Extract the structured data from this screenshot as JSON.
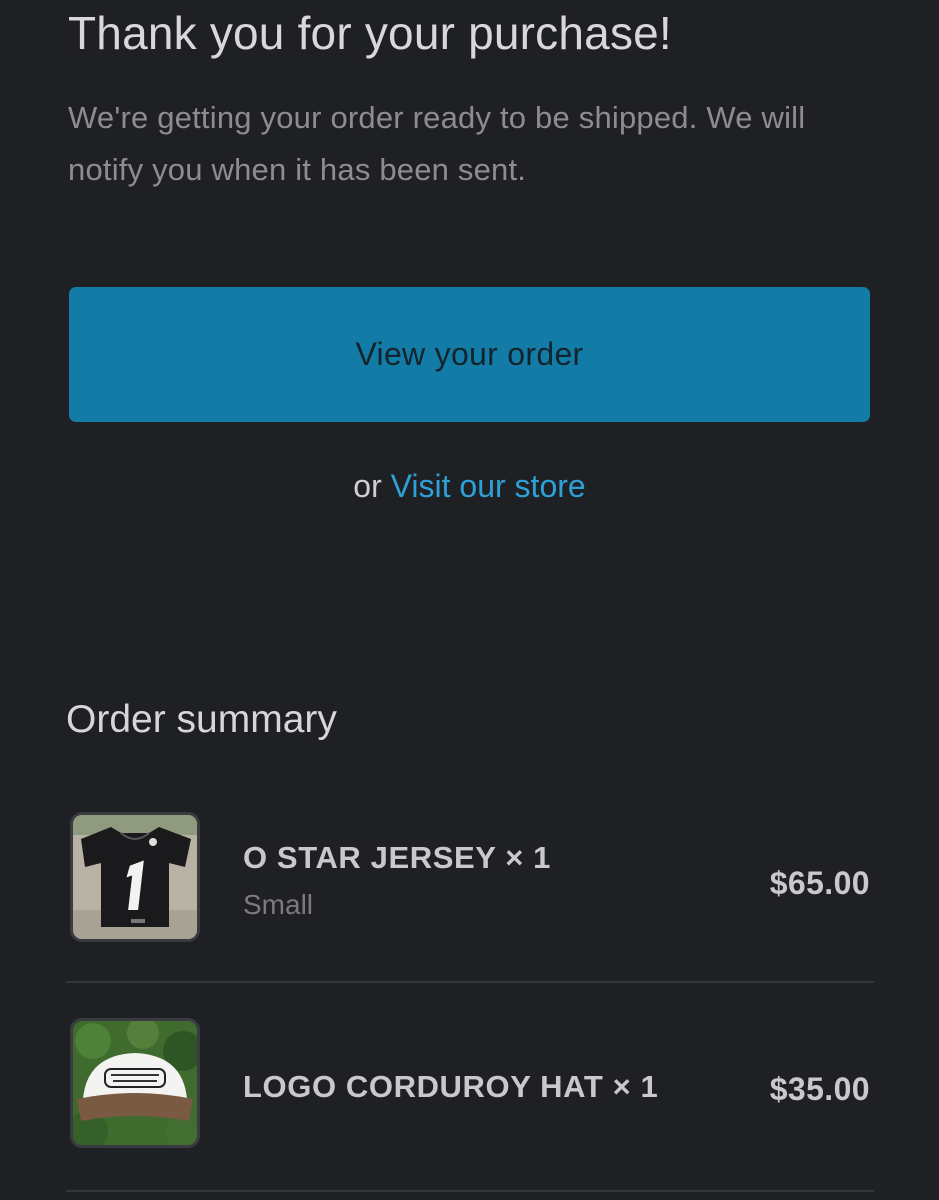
{
  "header": {
    "title": "Thank you for your purchase!",
    "subtitle": "We're getting your order ready to be shipped. We will notify you when it has been sent."
  },
  "actions": {
    "view_order_label": "View your order",
    "or_text": "or",
    "visit_store_label": "Visit our store"
  },
  "colors": {
    "background": "#1f2024",
    "primary_button": "#127ca6",
    "link": "#2da0d6"
  },
  "summary": {
    "title": "Order summary",
    "items": [
      {
        "name": "O STAR JERSEY × 1",
        "variant": "Small",
        "price": "$65.00",
        "image": "jersey-thumbnail"
      },
      {
        "name": "LOGO CORDUROY HAT × 1",
        "variant": "",
        "price": "$35.00",
        "image": "hat-thumbnail"
      }
    ]
  }
}
